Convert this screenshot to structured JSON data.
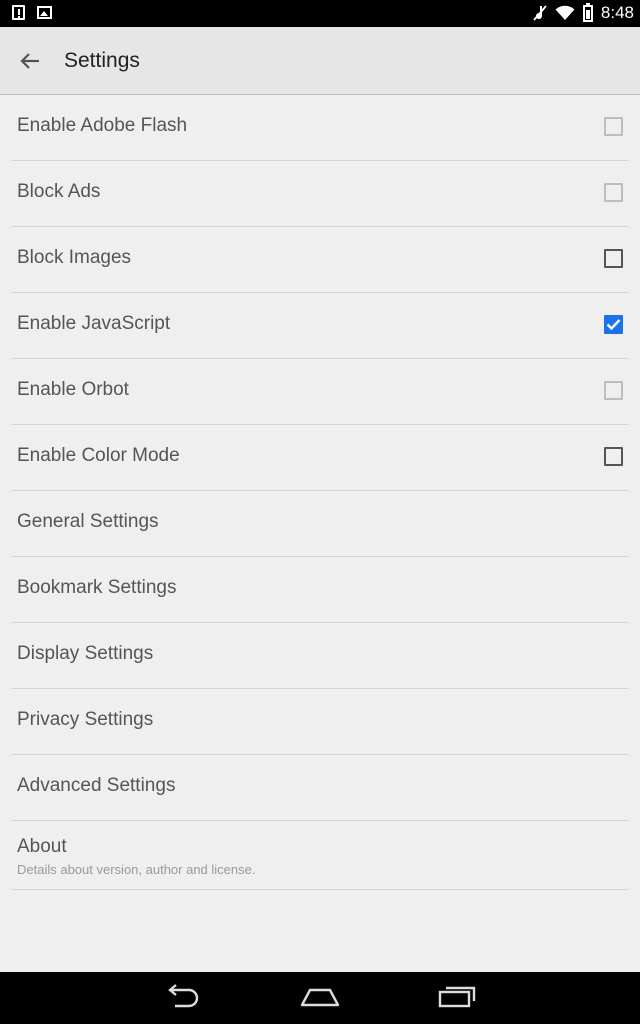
{
  "status_bar": {
    "time": "8:48",
    "icons": [
      "alert-notification-icon",
      "image-notification-icon",
      "no-sound-icon",
      "wifi-icon",
      "battery-icon"
    ]
  },
  "action_bar": {
    "title": "Settings",
    "back_icon": "arrow-back-icon"
  },
  "settings": [
    {
      "label": "Enable Adobe Flash",
      "checkbox": true,
      "checked": false,
      "enabled": false
    },
    {
      "label": "Block Ads",
      "checkbox": true,
      "checked": false,
      "enabled": false
    },
    {
      "label": "Block Images",
      "checkbox": true,
      "checked": false,
      "enabled": true
    },
    {
      "label": "Enable JavaScript",
      "checkbox": true,
      "checked": true,
      "enabled": true
    },
    {
      "label": "Enable Orbot",
      "checkbox": true,
      "checked": false,
      "enabled": false
    },
    {
      "label": "Enable Color Mode",
      "checkbox": true,
      "checked": false,
      "enabled": true
    },
    {
      "label": "General Settings",
      "checkbox": false
    },
    {
      "label": "Bookmark Settings",
      "checkbox": false
    },
    {
      "label": "Display Settings",
      "checkbox": false
    },
    {
      "label": "Privacy Settings",
      "checkbox": false
    },
    {
      "label": "Advanced Settings",
      "checkbox": false
    }
  ],
  "about": {
    "label": "About",
    "summary": "Details about version, author and license."
  },
  "nav_bar": {
    "icons": [
      "back-nav-icon",
      "home-nav-icon",
      "recents-nav-icon"
    ]
  },
  "colors": {
    "accent": "#1a73e8",
    "background": "#efefef",
    "action_bar": "#e6e6e6"
  }
}
